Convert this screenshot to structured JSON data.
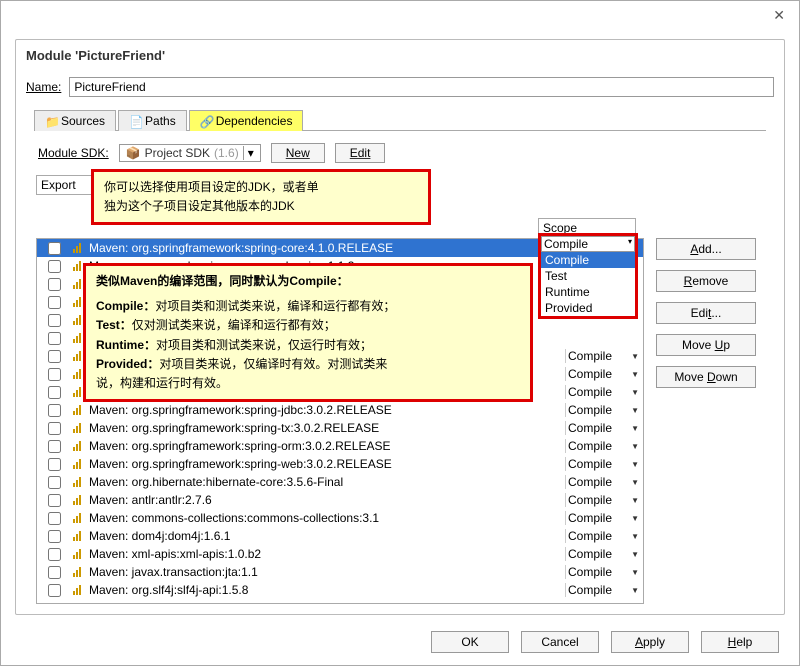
{
  "window": {
    "title": "Module 'PictureFriend'"
  },
  "name_row": {
    "label": "Name:",
    "value": "PictureFriend"
  },
  "tabs": {
    "t0": "Sources",
    "t1": "Paths",
    "t2": "Dependencies"
  },
  "sdk": {
    "label": "Module SDK:",
    "name": "Project SDK",
    "ver": "(1.6)",
    "new": "New",
    "edit": "Edit"
  },
  "headers": {
    "export": "Export",
    "scope": "Scope"
  },
  "side": {
    "add": "Add...",
    "remove": "Remove",
    "edit": "Edit...",
    "moveup": "Move Up",
    "movedown": "Move Down"
  },
  "dropdown": {
    "current": "Compile",
    "o0": "Compile",
    "o1": "Test",
    "o2": "Runtime",
    "o3": "Provided"
  },
  "callout1": {
    "l1": "你可以选择使用项目设定的JDK，或者单",
    "l2": "独为这个子项目设定其他版本的JDK"
  },
  "callout2": {
    "l1": "类似Maven的编译范围，同时默认为Compile：",
    "l2a": "Compile：",
    "l2b": "对项目类和测试类来说，编译和运行都有效；",
    "l3a": "Test：",
    "l3b": "仅对测试类来说，编译和运行都有效；",
    "l4a": "Runtime：",
    "l4b": "对项目类和测试类来说，仅运行时有效；",
    "l5a": "Provided：",
    "l5b": "对项目类来说，仅编译时有效。对测试类来",
    "l6": "说，构建和运行时有效。"
  },
  "rows": [
    {
      "txt": "Maven: org.springframework:spring-core:4.1.0.RELEASE",
      "scope": "Compile",
      "sel": true
    },
    {
      "txt": "Maven: commons-logging:commons-logging:1.1.3",
      "scope": "Compile"
    },
    {
      "txt": "",
      "scope": ""
    },
    {
      "txt": "",
      "scope": ""
    },
    {
      "txt": "",
      "scope": ""
    },
    {
      "txt": "",
      "scope": ""
    },
    {
      "txt": "",
      "scope": "Compile",
      "arr": true
    },
    {
      "txt": "",
      "scope": "Compile",
      "arr": true
    },
    {
      "txt": "",
      "scope": "Compile",
      "arr": true
    },
    {
      "txt": "Maven: org.springframework:spring-jdbc:3.0.2.RELEASE",
      "scope": "Compile",
      "arr": true
    },
    {
      "txt": "Maven: org.springframework:spring-tx:3.0.2.RELEASE",
      "scope": "Compile",
      "arr": true
    },
    {
      "txt": "Maven: org.springframework:spring-orm:3.0.2.RELEASE",
      "scope": "Compile",
      "arr": true
    },
    {
      "txt": "Maven: org.springframework:spring-web:3.0.2.RELEASE",
      "scope": "Compile",
      "arr": true
    },
    {
      "txt": "Maven: org.hibernate:hibernate-core:3.5.6-Final",
      "scope": "Compile",
      "arr": true
    },
    {
      "txt": "Maven: antlr:antlr:2.7.6",
      "scope": "Compile",
      "arr": true
    },
    {
      "txt": "Maven: commons-collections:commons-collections:3.1",
      "scope": "Compile",
      "arr": true
    },
    {
      "txt": "Maven: dom4j:dom4j:1.6.1",
      "scope": "Compile",
      "arr": true
    },
    {
      "txt": "Maven: xml-apis:xml-apis:1.0.b2",
      "scope": "Compile",
      "arr": true
    },
    {
      "txt": "Maven: javax.transaction:jta:1.1",
      "scope": "Compile",
      "arr": true
    },
    {
      "txt": "Maven: org.slf4j:slf4j-api:1.5.8",
      "scope": "Compile",
      "arr": true
    }
  ],
  "bottom": {
    "ok": "OK",
    "cancel": "Cancel",
    "apply": "Apply",
    "help": "Help"
  }
}
